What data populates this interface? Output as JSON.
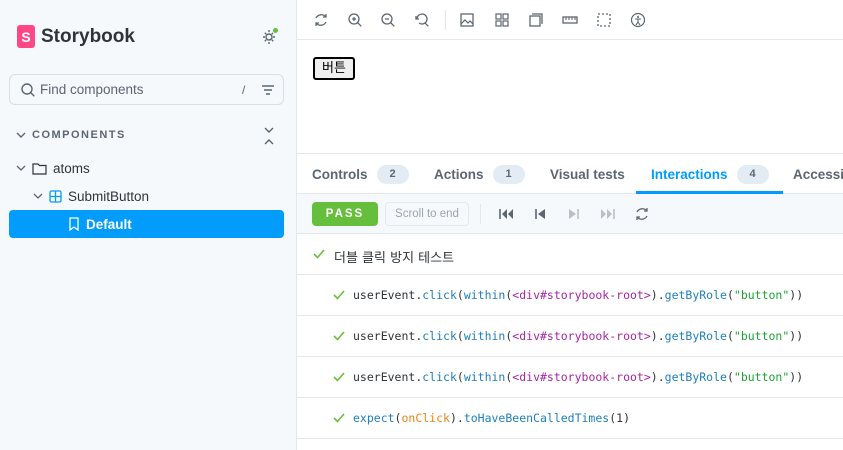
{
  "brand": {
    "name": "Storybook",
    "logo_letter": "S"
  },
  "search": {
    "placeholder": "Find components",
    "shortcut": "/"
  },
  "sidebar": {
    "section_title": "COMPONENTS",
    "items": [
      {
        "label": "atoms",
        "icon": "folder-icon"
      },
      {
        "label": "SubmitButton",
        "icon": "component-icon"
      },
      {
        "label": "Default",
        "icon": "bookmark-icon",
        "selected": true
      }
    ]
  },
  "preview": {
    "button_label": "버튼"
  },
  "tabs": [
    {
      "label": "Controls",
      "badge": "2"
    },
    {
      "label": "Actions",
      "badge": "1"
    },
    {
      "label": "Visual tests",
      "badge": ""
    },
    {
      "label": "Interactions",
      "badge": "4",
      "active": true
    },
    {
      "label": "Accessibility",
      "badge": ""
    }
  ],
  "interactions": {
    "status": "PASS",
    "scroll_label": "Scroll to end",
    "test_title": "더블 클릭 방지 테스트",
    "steps": [
      {
        "obj": "userEvent",
        "method": "click",
        "within": "within",
        "tag": "<div#storybook-root>",
        "getter": "getByRole",
        "arg": "\"button\""
      },
      {
        "obj": "userEvent",
        "method": "click",
        "within": "within",
        "tag": "<div#storybook-root>",
        "getter": "getByRole",
        "arg": "\"button\""
      },
      {
        "obj": "userEvent",
        "method": "click",
        "within": "within",
        "tag": "<div#storybook-root>",
        "getter": "getByRole",
        "arg": "\"button\""
      }
    ],
    "expect": {
      "fn": "expect",
      "arg": "onClick",
      "matcher": "toHaveBeenCalledTimes",
      "value": "1"
    }
  },
  "colors": {
    "accent": "#029cfd",
    "pass": "#66bf3c",
    "brand": "#ff4785"
  }
}
